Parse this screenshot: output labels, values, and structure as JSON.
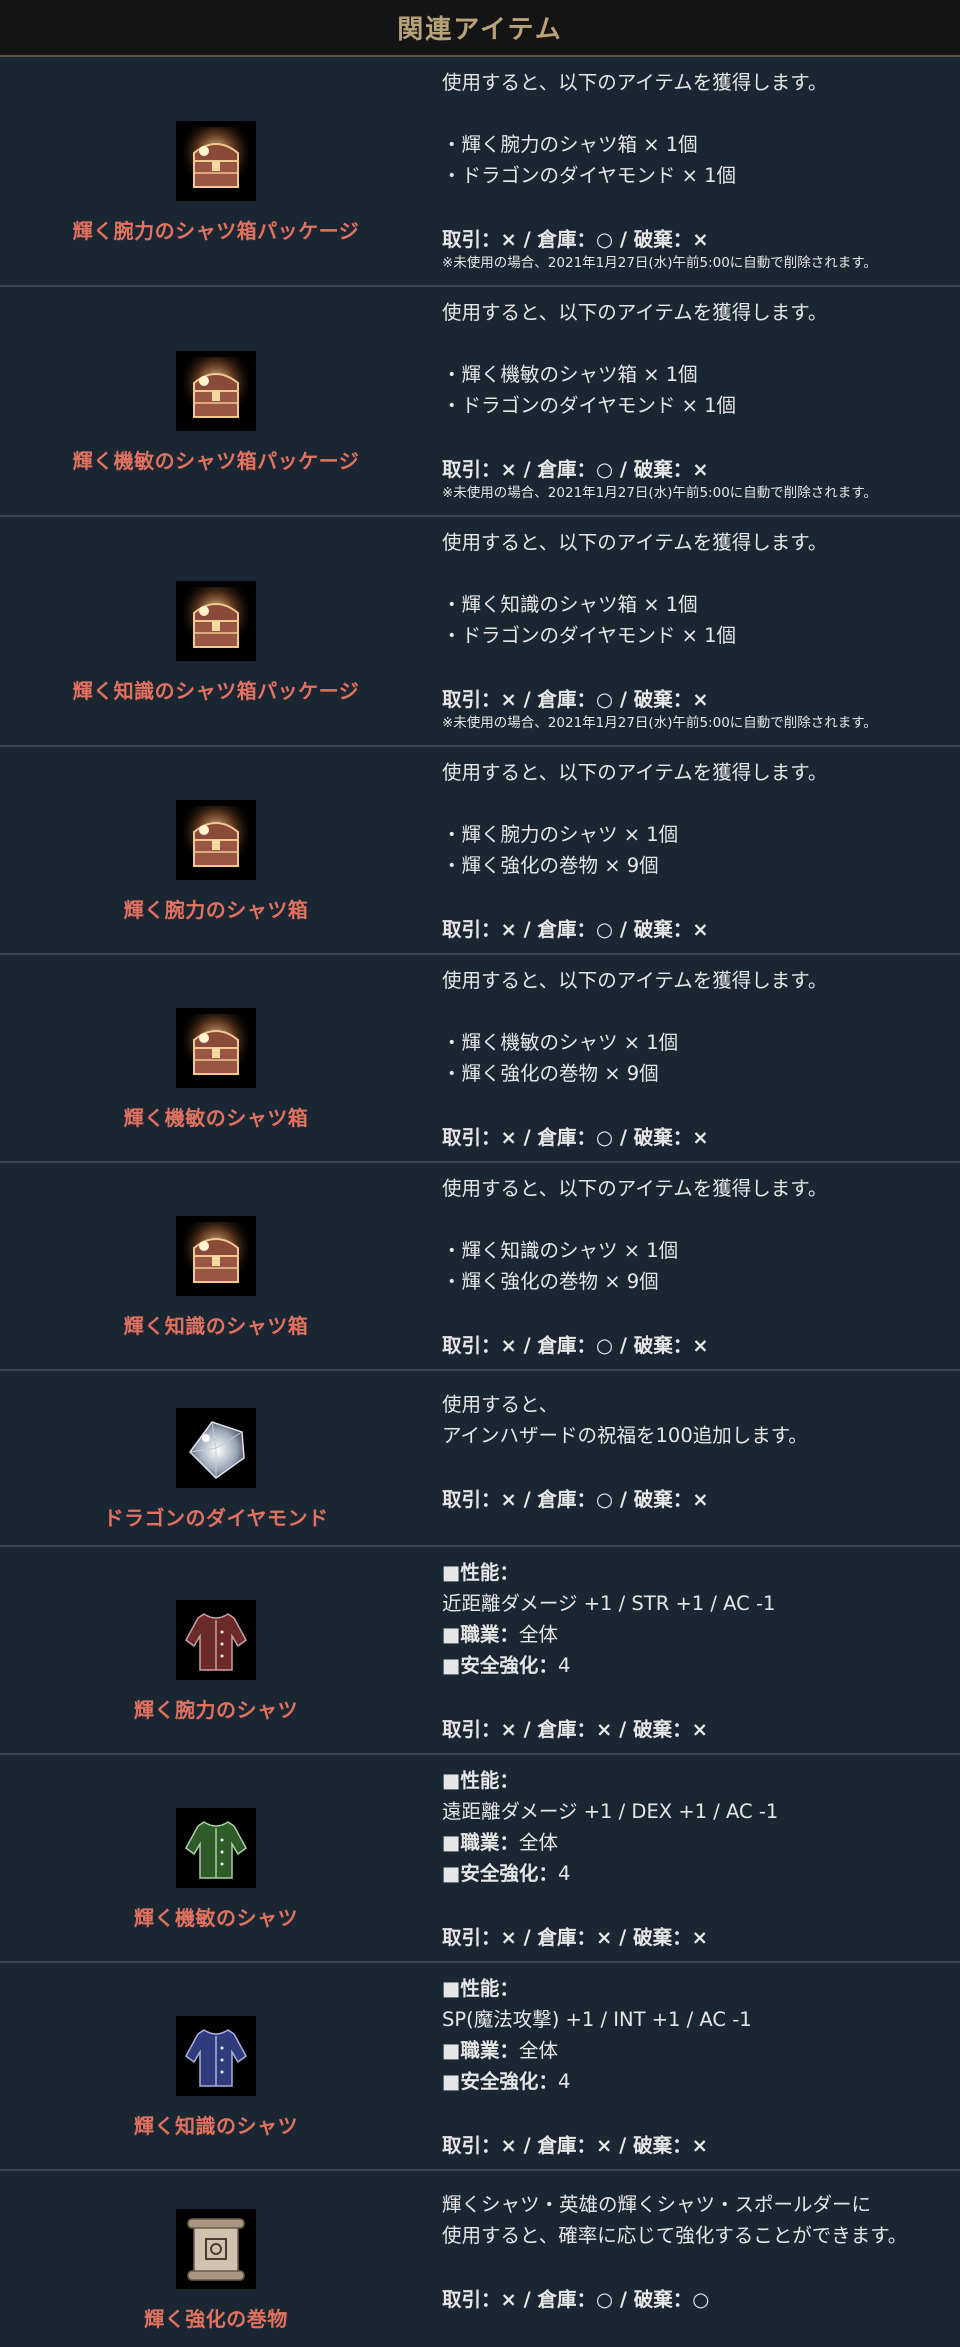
{
  "header": {
    "title": "関連アイテム"
  },
  "items": [
    {
      "name": "輝く腕力のシャツ箱パッケージ",
      "icon": "treasure-chest-icon",
      "intro": "使用すると、以下のアイテムを獲得します。",
      "contents": [
        "・輝く腕力のシャツ箱 × 1個",
        "・ドラゴンのダイヤモンド × 1個"
      ],
      "trade": "取引：× / 倉庫：○ / 破棄：×",
      "note": "※未使用の場合、2021年1月27日(水)午前5:00に自動で削除されます。"
    },
    {
      "name": "輝く機敏のシャツ箱パッケージ",
      "icon": "treasure-chest-icon",
      "intro": "使用すると、以下のアイテムを獲得します。",
      "contents": [
        "・輝く機敏のシャツ箱 × 1個",
        "・ドラゴンのダイヤモンド × 1個"
      ],
      "trade": "取引：× / 倉庫：○ / 破棄：×",
      "note": "※未使用の場合、2021年1月27日(水)午前5:00に自動で削除されます。"
    },
    {
      "name": "輝く知識のシャツ箱パッケージ",
      "icon": "treasure-chest-icon",
      "intro": "使用すると、以下のアイテムを獲得します。",
      "contents": [
        "・輝く知識のシャツ箱 × 1個",
        "・ドラゴンのダイヤモンド × 1個"
      ],
      "trade": "取引：× / 倉庫：○ / 破棄：×",
      "note": "※未使用の場合、2021年1月27日(水)午前5:00に自動で削除されます。"
    },
    {
      "name": "輝く腕力のシャツ箱",
      "icon": "treasure-chest-icon",
      "intro": "使用すると、以下のアイテムを獲得します。",
      "contents": [
        "・輝く腕力のシャツ × 1個",
        "・輝く強化の巻物 × 9個"
      ],
      "trade": "取引：× / 倉庫：○ / 破棄：×"
    },
    {
      "name": "輝く機敏のシャツ箱",
      "icon": "treasure-chest-icon",
      "intro": "使用すると、以下のアイテムを獲得します。",
      "contents": [
        "・輝く機敏のシャツ × 1個",
        "・輝く強化の巻物 × 9個"
      ],
      "trade": "取引：× / 倉庫：○ / 破棄：×"
    },
    {
      "name": "輝く知識のシャツ箱",
      "icon": "treasure-chest-icon",
      "intro": "使用すると、以下のアイテムを獲得します。",
      "contents": [
        "・輝く知識のシャツ × 1個",
        "・輝く強化の巻物 × 9個"
      ],
      "trade": "取引：× / 倉庫：○ / 破棄：×"
    },
    {
      "name": "ドラゴンのダイヤモンド",
      "icon": "diamond-icon",
      "desc": [
        "使用すると、",
        "アインハザードの祝福を100追加します。"
      ],
      "trade": "取引：× / 倉庫：○ / 破棄：×"
    },
    {
      "name": "輝く腕力のシャツ",
      "icon": "red-shirt-icon",
      "color": "#6b2a2a",
      "perf_label": "■性能：",
      "perf": "近距離ダメージ +1 / STR +1 / AC -1",
      "class_label": "■職業：",
      "class": "全体",
      "safe_label": "■安全強化：",
      "safe": "4",
      "trade": "取引：× / 倉庫：× / 破棄：×"
    },
    {
      "name": "輝く機敏のシャツ",
      "icon": "green-shirt-icon",
      "color": "#2f5a2a",
      "perf_label": "■性能：",
      "perf": "遠距離ダメージ +1 / DEX +1 / AC -1",
      "class_label": "■職業：",
      "class": "全体",
      "safe_label": "■安全強化：",
      "safe": "4",
      "trade": "取引：× / 倉庫：× / 破棄：×"
    },
    {
      "name": "輝く知識のシャツ",
      "icon": "blue-shirt-icon",
      "color": "#2f3b7a",
      "perf_label": "■性能：",
      "perf": "SP(魔法攻撃) +1 / INT +1 / AC -1",
      "class_label": "■職業：",
      "class": "全体",
      "safe_label": "■安全強化：",
      "safe": "4",
      "trade": "取引：× / 倉庫：× / 破棄：×"
    },
    {
      "name": "輝く強化の巻物",
      "icon": "scroll-icon",
      "desc": [
        "輝くシャツ・英雄の輝くシャツ・スポールダーに",
        "使用すると、確率に応じて強化することができます。"
      ],
      "trade": "取引：× / 倉庫：○ / 破棄：○"
    }
  ]
}
